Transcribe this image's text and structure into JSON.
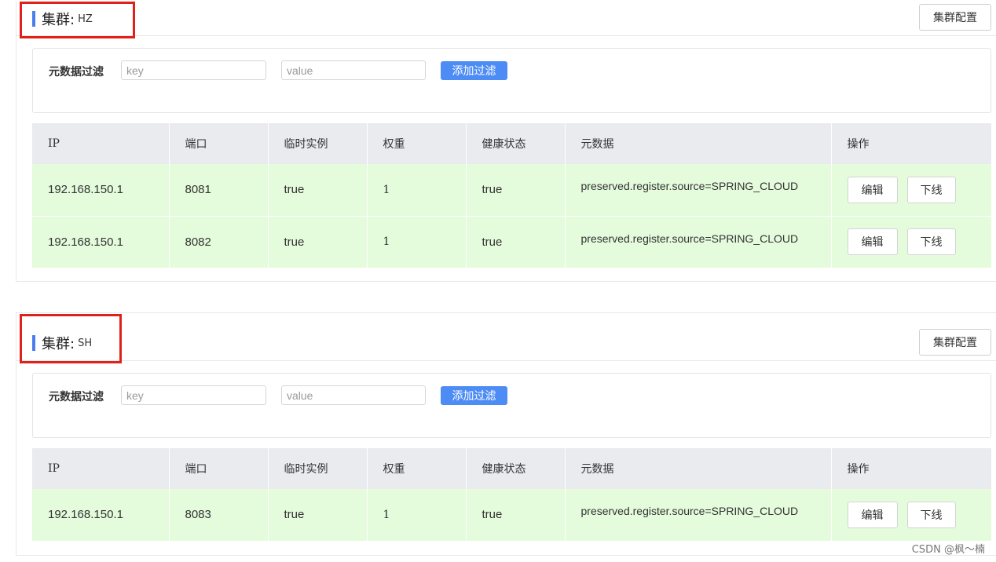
{
  "clusters": [
    {
      "title_label": "集群:",
      "name": "HZ",
      "config_button": "集群配置",
      "filter": {
        "label": "元数据过滤",
        "key_placeholder": "key",
        "value_placeholder": "value",
        "add_button": "添加过滤"
      },
      "columns": [
        "IP",
        "端口",
        "临时实例",
        "权重",
        "健康状态",
        "元数据",
        "操作"
      ],
      "rows": [
        {
          "ip": "192.168.150.1",
          "port": "8081",
          "ephemeral": "true",
          "weight": "1",
          "healthy": "true",
          "metadata": "preserved.register.source=SPRING_CLOUD",
          "edit": "编辑",
          "offline": "下线"
        },
        {
          "ip": "192.168.150.1",
          "port": "8082",
          "ephemeral": "true",
          "weight": "1",
          "healthy": "true",
          "metadata": "preserved.register.source=SPRING_CLOUD",
          "edit": "编辑",
          "offline": "下线"
        }
      ]
    },
    {
      "title_label": "集群:",
      "name": "SH",
      "config_button": "集群配置",
      "filter": {
        "label": "元数据过滤",
        "key_placeholder": "key",
        "value_placeholder": "value",
        "add_button": "添加过滤"
      },
      "columns": [
        "IP",
        "端口",
        "临时实例",
        "权重",
        "健康状态",
        "元数据",
        "操作"
      ],
      "rows": [
        {
          "ip": "192.168.150.1",
          "port": "8083",
          "ephemeral": "true",
          "weight": "1",
          "healthy": "true",
          "metadata": "preserved.register.source=SPRING_CLOUD",
          "edit": "编辑",
          "offline": "下线"
        }
      ]
    }
  ],
  "watermark": "CSDN @枫～楠",
  "colors": {
    "accent_bar": "#4a7df0",
    "highlight_box": "#e0201b",
    "primary_button": "#4d8cf5",
    "row_background": "#e4fbdc",
    "header_background": "#e9ebef"
  }
}
